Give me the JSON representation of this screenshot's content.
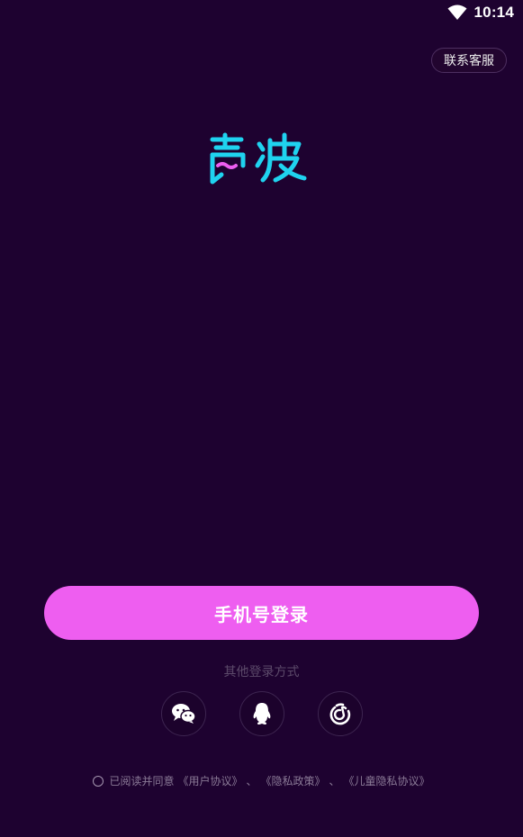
{
  "status_bar": {
    "time": "10:14",
    "wifi_icon": "wifi-icon"
  },
  "header": {
    "support_label": "联系客服"
  },
  "logo": {
    "text": "声波",
    "primary_color": "#1fd3ef",
    "accent_color": "#ee5ef0"
  },
  "main": {
    "phone_login_label": "手机号登录",
    "other_login_label": "其他登录方式",
    "social_logins": [
      {
        "name": "wechat",
        "icon": "wechat-icon"
      },
      {
        "name": "qq",
        "icon": "qq-icon"
      },
      {
        "name": "netease",
        "icon": "netease-music-icon"
      }
    ]
  },
  "agreement": {
    "prefix": "已阅读并同意",
    "user_agreement": "《用户协议》",
    "sep1": "、",
    "privacy_policy": "《隐私政策》",
    "sep2": "、",
    "children_privacy": "《儿童隐私协议》"
  },
  "colors": {
    "background": "#1e0230",
    "accent": "#ee5ef0"
  }
}
